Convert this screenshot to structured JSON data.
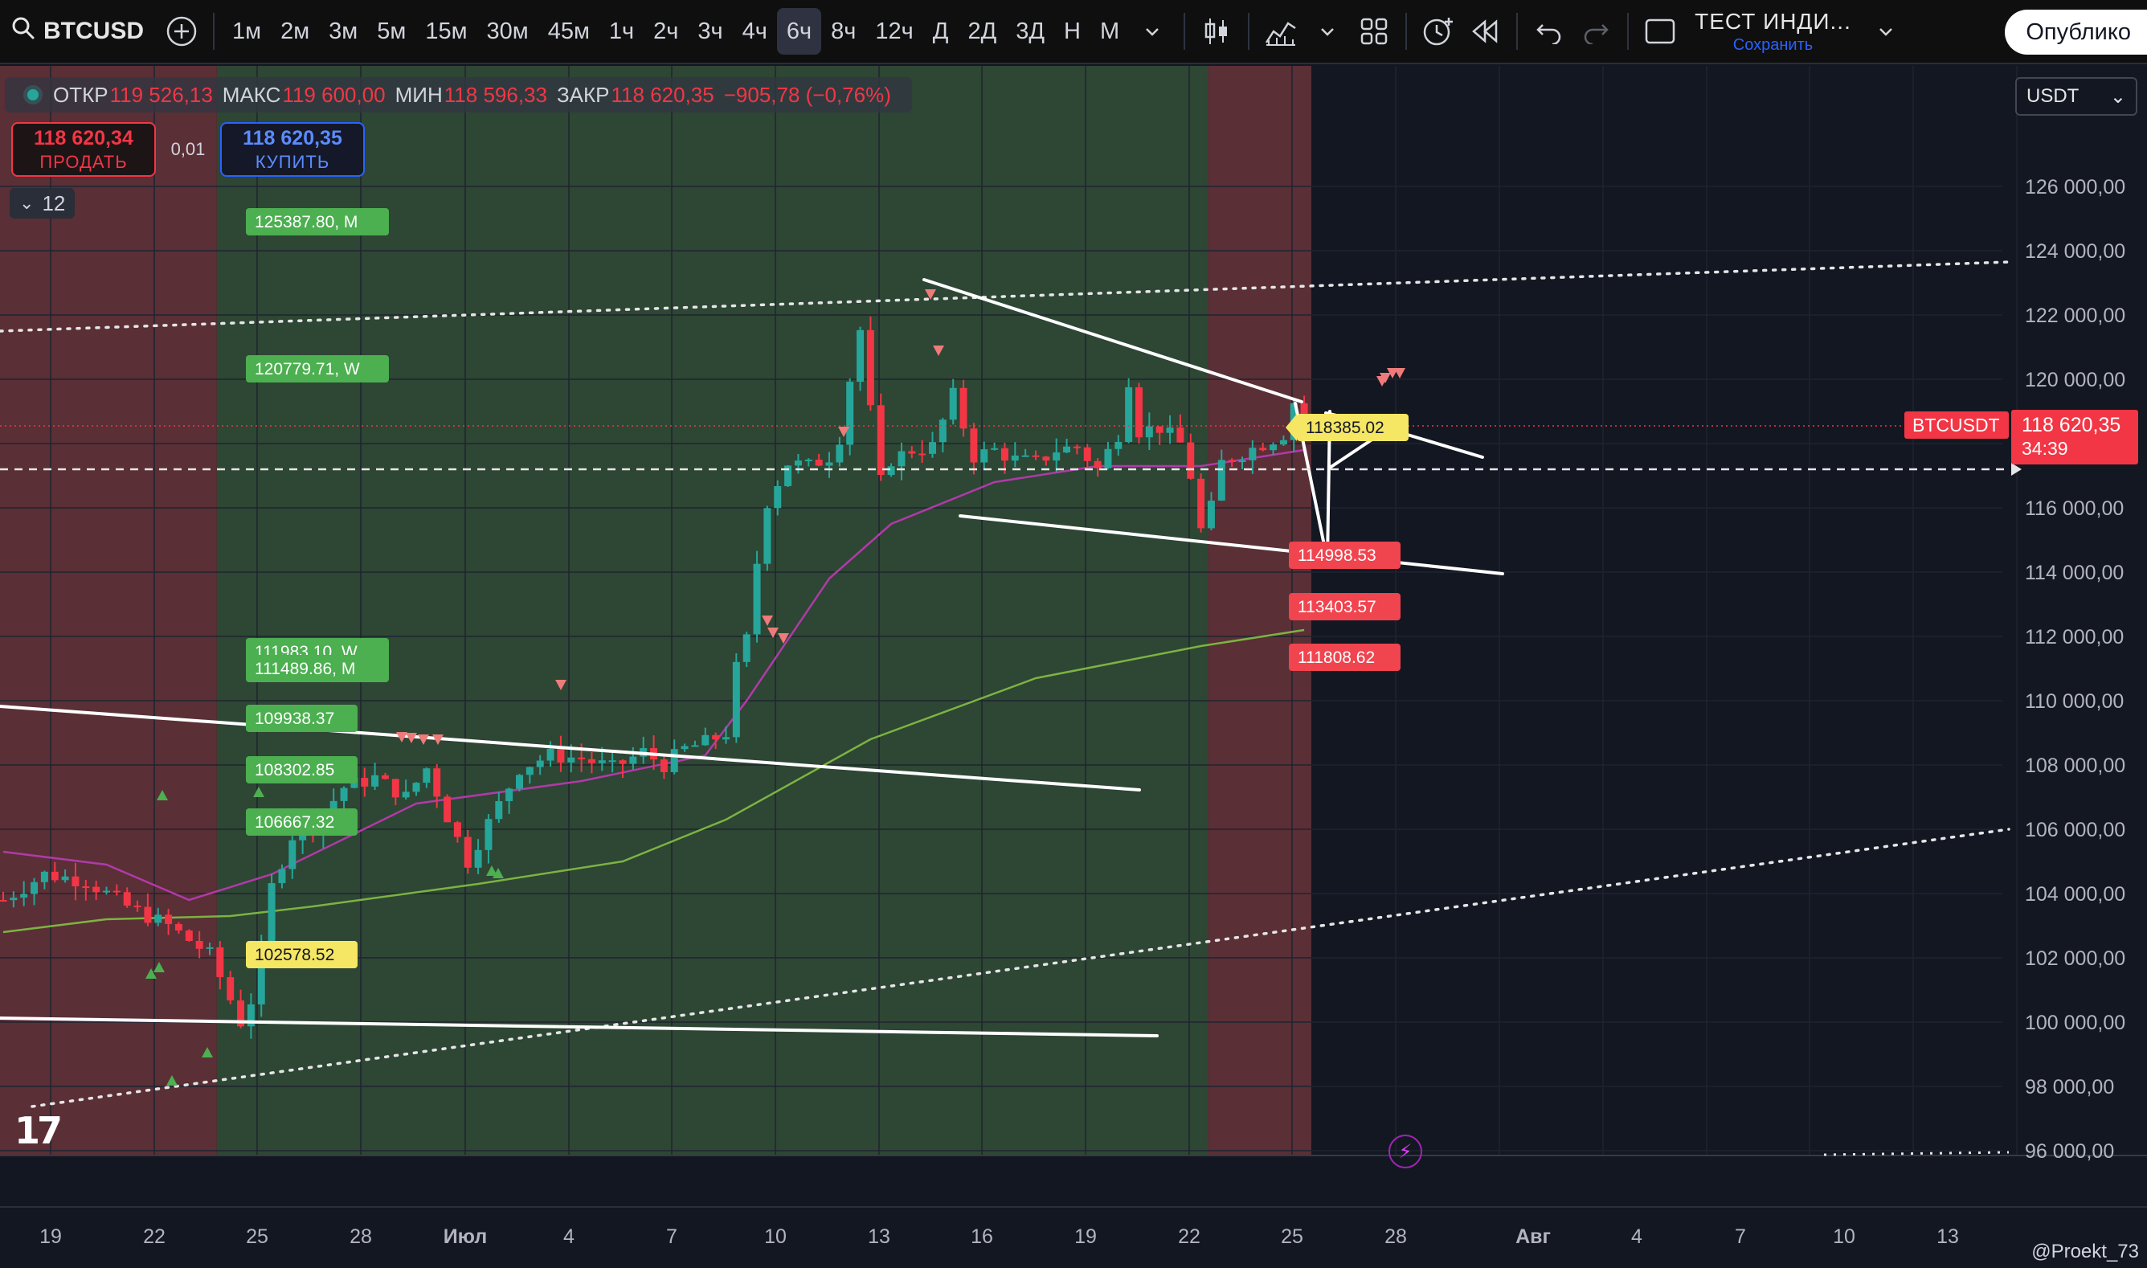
{
  "toolbar": {
    "symbol": "BTCUSD",
    "intervals": [
      "1м",
      "2м",
      "3м",
      "5м",
      "15м",
      "30м",
      "45м",
      "1ч",
      "2ч",
      "3ч",
      "4ч",
      "6ч",
      "8ч",
      "12ч",
      "Д",
      "2Д",
      "3Д",
      "Н",
      "М"
    ],
    "active_interval": "6ч",
    "layout_name": "ТЕСТ ИНДИ...",
    "layout_save": "Сохранить",
    "publish": "Опублико"
  },
  "legend": {
    "open_label": "ОТКР",
    "open": "119 526,13",
    "high_label": "МАКС",
    "high": "119 600,00",
    "low_label": "МИН",
    "low": "118 596,33",
    "close_label": "ЗАКР",
    "close": "118 620,35",
    "change": "−905,78 (−0,76%)"
  },
  "trade": {
    "sell_price": "118 620,34",
    "sell_label": "ПРОДАТЬ",
    "qty": "0,01",
    "buy_price": "118 620,35",
    "buy_label": "КУПИТЬ"
  },
  "collapse_count": "12",
  "currency": "USDT",
  "watermark": "@Proekt_73",
  "colors": {
    "up": "#26a69a",
    "down": "#f23645",
    "bg": "#131722",
    "green_zone": "#2e4634",
    "red_zone": "#5a2f36"
  },
  "chart_data": {
    "type": "candlestick",
    "title": "BTCUSD",
    "interval": "6ч",
    "x_ticks": [
      "19",
      "22",
      "25",
      "28",
      "Июл",
      "4",
      "7",
      "10",
      "13",
      "16",
      "19",
      "22",
      "25",
      "28",
      "Авг",
      "4",
      "7",
      "10",
      "13"
    ],
    "ylim": [
      96000,
      128000
    ],
    "y_ticks": [
      "96 000,00",
      "98 000,00",
      "100 000,00",
      "102 000,00",
      "104 000,00",
      "106 000,00",
      "108 000,00",
      "110 000,00",
      "112 000,00",
      "114 000,00",
      "116 000,00",
      "118 000,00",
      "120 000,00",
      "122 000,00",
      "124 000,00",
      "126 000,00"
    ],
    "last_price_label": "BTCUSDT",
    "last_price": "118 620,35",
    "countdown": "34:39",
    "candles_anchor": [
      [
        0,
        103800
      ],
      [
        4,
        104600
      ],
      [
        8,
        104400
      ],
      [
        12,
        103600
      ],
      [
        16,
        103000
      ],
      [
        20,
        102100
      ],
      [
        23,
        100000
      ],
      [
        24.5,
        101000
      ],
      [
        26,
        104200
      ],
      [
        28,
        105800
      ],
      [
        30,
        106100
      ],
      [
        33,
        107300
      ],
      [
        36,
        107600
      ],
      [
        39,
        107000
      ],
      [
        41,
        107900
      ],
      [
        43,
        106400
      ],
      [
        45,
        105000
      ],
      [
        47,
        106200
      ],
      [
        50,
        107900
      ],
      [
        53,
        108300
      ],
      [
        56,
        108200
      ],
      [
        59,
        107900
      ],
      [
        62,
        108400
      ],
      [
        64,
        108000
      ],
      [
        66,
        108500
      ],
      [
        68,
        108700
      ],
      [
        70,
        109000
      ],
      [
        71,
        111000
      ],
      [
        72,
        111900
      ],
      [
        73,
        114300
      ],
      [
        74,
        116200
      ],
      [
        76,
        117400
      ],
      [
        78,
        117300
      ],
      [
        80,
        117600
      ],
      [
        81,
        118200
      ],
      [
        82,
        120000
      ],
      [
        82.6,
        122600
      ],
      [
        83.2,
        121000
      ],
      [
        84,
        119000
      ],
      [
        85,
        116800
      ],
      [
        86,
        117500
      ],
      [
        88,
        117800
      ],
      [
        90,
        117900
      ],
      [
        92,
        119500
      ],
      [
        94,
        117600
      ],
      [
        96,
        117800
      ],
      [
        98,
        117500
      ],
      [
        100,
        117400
      ],
      [
        102,
        117800
      ],
      [
        104,
        117900
      ],
      [
        106,
        117200
      ],
      [
        108,
        118300
      ],
      [
        109,
        120000
      ],
      [
        110,
        118400
      ],
      [
        112,
        118500
      ],
      [
        114,
        118000
      ],
      [
        115,
        117000
      ],
      [
        116,
        115300
      ],
      [
        117,
        116000
      ],
      [
        118,
        117400
      ],
      [
        120,
        117700
      ],
      [
        122,
        118000
      ],
      [
        124,
        118300
      ],
      [
        125,
        119300
      ],
      [
        126,
        118620
      ]
    ],
    "moving_averages": [
      {
        "color": "#b03aa8",
        "values": [
          [
            0,
            105300
          ],
          [
            10,
            104900
          ],
          [
            18,
            103800
          ],
          [
            26,
            104600
          ],
          [
            40,
            106800
          ],
          [
            56,
            107500
          ],
          [
            68,
            108300
          ],
          [
            72,
            110000
          ],
          [
            80,
            113800
          ],
          [
            86,
            115500
          ],
          [
            96,
            116800
          ],
          [
            106,
            117300
          ],
          [
            116,
            117300
          ],
          [
            126,
            117800
          ]
        ]
      },
      {
        "color": "#7cb342",
        "values": [
          [
            0,
            102800
          ],
          [
            10,
            103200
          ],
          [
            22,
            103300
          ],
          [
            30,
            103600
          ],
          [
            46,
            104300
          ],
          [
            60,
            105000
          ],
          [
            70,
            106300
          ],
          [
            84,
            108800
          ],
          [
            100,
            110700
          ],
          [
            116,
            111700
          ],
          [
            126,
            112200
          ]
        ]
      }
    ],
    "price_labels": [
      {
        "text": "125387.80, M",
        "value": 125387.8,
        "color": "#4caf50"
      },
      {
        "text": "120779.71, W",
        "value": 120779.71,
        "color": "#4caf50"
      },
      {
        "text": "111983.10, W",
        "value": 111983.1,
        "color": "#4caf50"
      },
      {
        "text": "111489.86, M",
        "value": 111489.86,
        "color": "#4caf50"
      },
      {
        "text": "109938.37",
        "value": 109938.37,
        "color": "#4caf50"
      },
      {
        "text": "108302.85",
        "value": 108302.85,
        "color": "#4caf50"
      },
      {
        "text": "106667.32",
        "value": 106667.32,
        "color": "#4caf50"
      },
      {
        "text": "102578.52",
        "value": 102578.52,
        "color": "#ffeb3b"
      },
      {
        "text": "118385.02",
        "value": 118385.02,
        "color": "#ffeb3b"
      },
      {
        "text": "114998.53",
        "value": 114998.53,
        "color": "#f23645"
      },
      {
        "text": "113403.57",
        "value": 113403.57,
        "color": "#f23645"
      },
      {
        "text": "111808.62",
        "value": 111808.62,
        "color": "#f23645"
      }
    ],
    "zones": [
      {
        "from": 0,
        "to": 21,
        "color": "red"
      },
      {
        "from": 21,
        "to": 117,
        "color": "green"
      },
      {
        "from": 117,
        "to": 127,
        "color": "red"
      }
    ],
    "grid": true,
    "legend_position": "top-left"
  }
}
